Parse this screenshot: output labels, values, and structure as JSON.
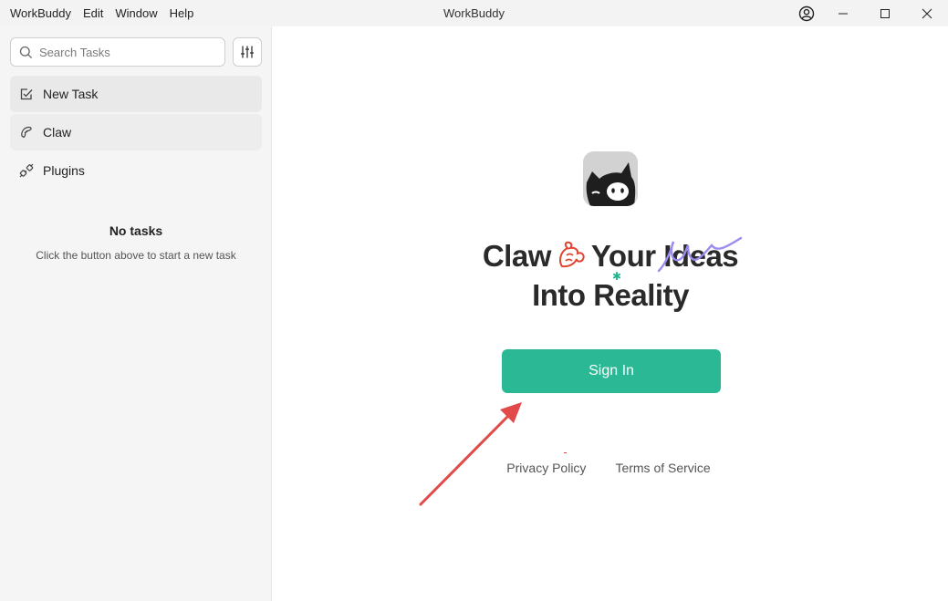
{
  "app": {
    "title": "WorkBuddy",
    "menu": [
      "WorkBuddy",
      "Edit",
      "Window",
      "Help"
    ]
  },
  "window_controls": {
    "account_icon": "account-circle-icon",
    "minimize_icon": "minimize-icon",
    "maximize_icon": "maximize-icon",
    "close_icon": "close-icon"
  },
  "sidebar": {
    "search": {
      "placeholder": "Search Tasks",
      "value": ""
    },
    "filter_icon": "sliders-icon",
    "items": [
      {
        "label": "New Task",
        "icon": "checkbox-edit-icon",
        "state": "active"
      },
      {
        "label": "Claw",
        "icon": "claw-icon",
        "state": "hover"
      },
      {
        "label": "Plugins",
        "icon": "plugin-icon",
        "state": "normal"
      }
    ],
    "empty": {
      "title": "No tasks",
      "subtitle": "Click the button above to start a new task"
    }
  },
  "main": {
    "logo_icon": "cat-logo-icon",
    "headline_line1_a": "Claw",
    "headline_line1_b": "Your Ideas",
    "headline_line2": "Into Reality",
    "signin_label": "Sign In",
    "links": [
      "Privacy Policy",
      "Terms of Service"
    ]
  },
  "colors": {
    "accent": "#2bb895",
    "scribble": "#9b8cf0",
    "annotation_arrow": "#e24a4a",
    "claw_glyph": "#e0432f"
  }
}
